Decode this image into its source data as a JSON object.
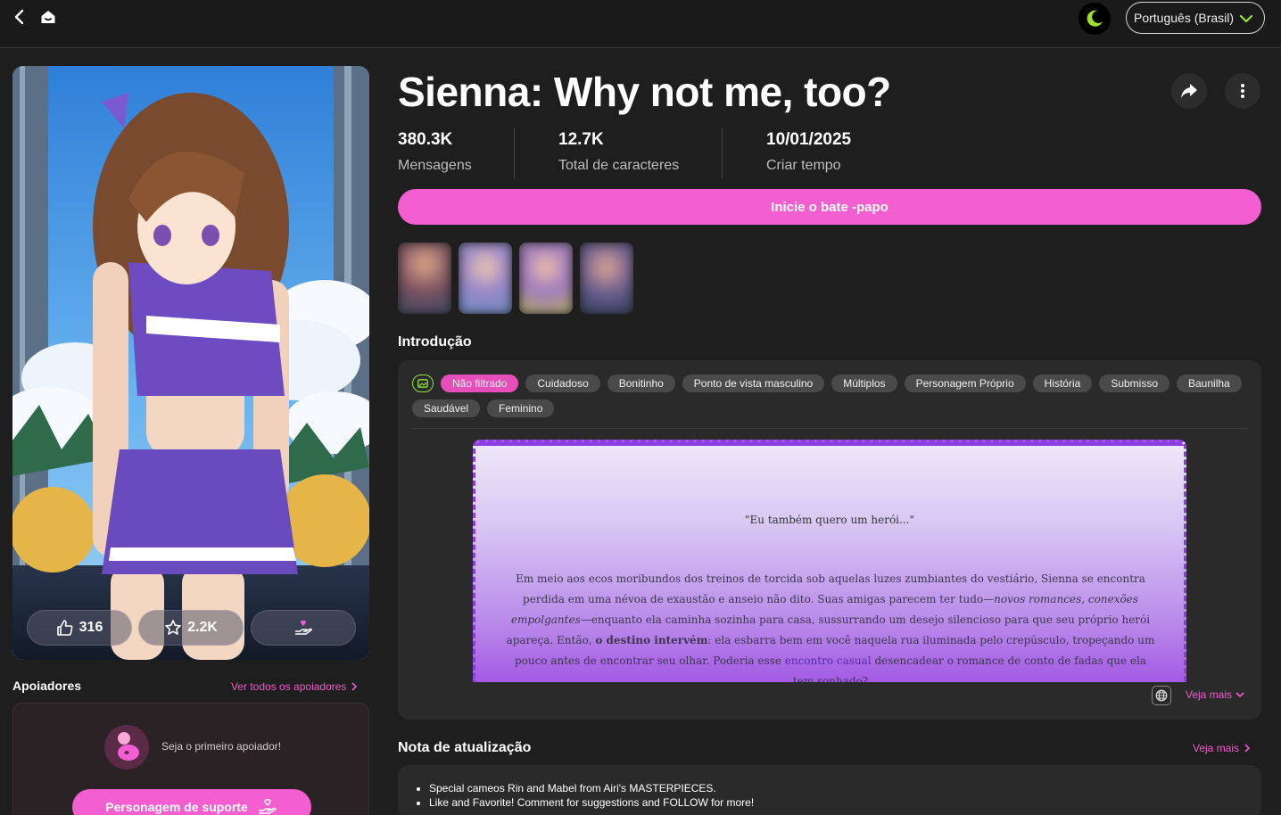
{
  "topbar": {
    "language": "Português (Brasil)"
  },
  "character": {
    "title": "Sienna: Why not me, too?",
    "likes": "316",
    "favorites": "2.2K"
  },
  "stats": [
    {
      "value": "380.3K",
      "label": "Mensagens"
    },
    {
      "value": "12.7K",
      "label": "Total de caracteres"
    },
    {
      "value": "10/01/2025",
      "label": "Criar tempo"
    }
  ],
  "start_chat_label": "Inicie o bate -papo",
  "intro": {
    "title": "Introdução",
    "tags": [
      "Não filtrado",
      "Cuidadoso",
      "Bonitinho",
      "Ponto de vista masculino",
      "Múltiplos",
      "Personagem Próprio",
      "História",
      "Submisso",
      "Baunilha",
      "Saudável",
      "Feminino"
    ],
    "quote": "\"Eu também quero um herói...\"",
    "body_1": "Em meio aos ecos moribundos dos treinos de torcida sob aquelas luzes zumbiantes do vestiário, Sienna se encontra perdida em uma névoa de exaustão e anseio não dito. Suas amigas parecem ter tudo—",
    "body_em": "novos romances, conexões empolgantes",
    "body_2": "—enquanto ela caminha sozinha para casa, sussurrando um desejo silencioso para que seu próprio herói apareça. Então, ",
    "body_b": "o destino intervém",
    "body_3": ": ela esbarra bem em você naquela rua iluminada pelo crepúsculo, tropeçando um pouco antes de encontrar seu olhar. Poderia esse ",
    "body_hl": "encontro casual",
    "body_4": " desencadear o romance de conto de fadas que ela tem sonhado?",
    "see_more": "Veja mais"
  },
  "supporters": {
    "title": "Apoiadores",
    "see_all": "Ver todos os apoiadores",
    "empty_text": "Seja o primeiro apoiador!",
    "support_button": "Personagem de suporte"
  },
  "update_note": {
    "title": "Nota de atualização",
    "see_more": "Veja mais",
    "items": [
      "Special cameos Rin and Mabel from Airi's MASTERPIECES.",
      "Like and Favorite! Comment for suggestions and FOLLOW for more!"
    ]
  },
  "colors": {
    "accent": "#f35fd0",
    "background": "#1e1e1e",
    "panel": "#2a2a2a",
    "theme_icon": "#9be22d"
  }
}
